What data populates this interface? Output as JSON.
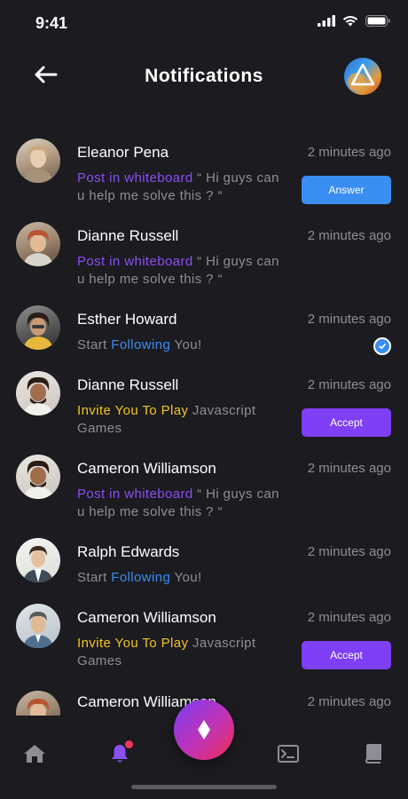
{
  "status_bar": {
    "time": "9:41"
  },
  "header": {
    "title": "Notifications"
  },
  "notifications": [
    {
      "name": "Eleanor Pena",
      "time": "2 minutes ago",
      "highlight": "Post in whiteboard",
      "text": " “ Hi guys can u help me solve this ? “",
      "action": "Answer"
    },
    {
      "name": "Dianne Russell",
      "time": "2 minutes ago",
      "highlight": "Post in whiteboard",
      "text": " “ Hi guys can u help me solve this ? “"
    },
    {
      "name": "Esther Howard",
      "time": "2 minutes ago",
      "prefix": "Start ",
      "highlight": "Following",
      "text": " You!"
    },
    {
      "name": "Dianne Russell",
      "time": "2 minutes ago",
      "highlight": "Invite You To Play",
      "text": " Javascript Games",
      "action": "Accept"
    },
    {
      "name": "Cameron Williamson",
      "time": "2 minutes ago",
      "highlight": "Post in whiteboard",
      "text": " “ Hi guys can u help me solve this ? “"
    },
    {
      "name": "Ralph Edwards",
      "time": "2 minutes ago",
      "prefix": "Start ",
      "highlight": "Following",
      "text": " You!"
    },
    {
      "name": "Cameron Williamson",
      "time": "2 minutes ago",
      "highlight": "Invite You To Play",
      "text": " Javascript Games",
      "action": "Accept"
    },
    {
      "name": "Cameron Williamson",
      "time": "2 minutes ago"
    }
  ],
  "bottom_nav": [
    "home-icon",
    "bell-icon",
    "terminal-icon",
    "book-icon"
  ],
  "colors": {
    "background": "#1b1b20",
    "purple": "#8b4ff2",
    "blue": "#3a8ef2",
    "yellow": "#f5c41e",
    "muted": "#8e8e96"
  }
}
